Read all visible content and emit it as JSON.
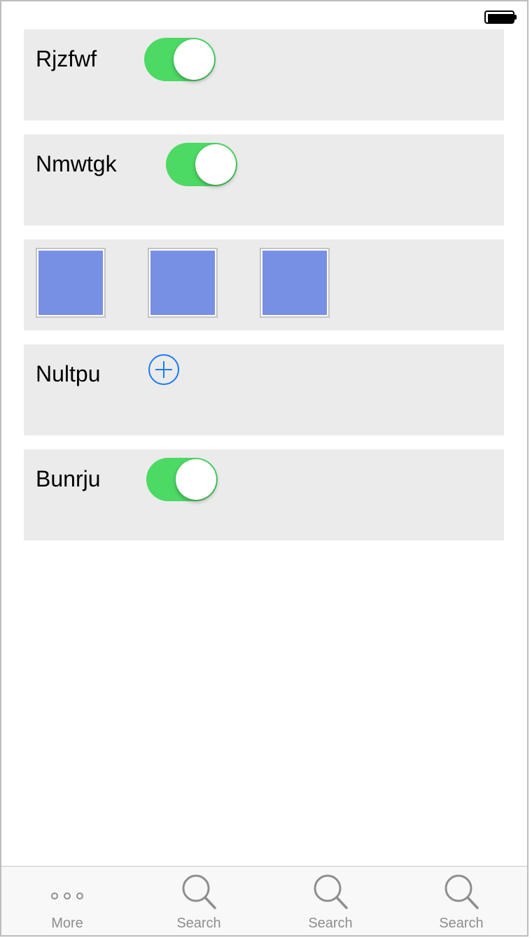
{
  "rows": [
    {
      "label": "Rjzfwf",
      "toggle_on": true
    },
    {
      "label": "Nmwtgk",
      "toggle_on": true
    },
    {
      "thumbnails": [
        "image-1",
        "image-2",
        "image-3"
      ]
    },
    {
      "label": "Nultpu",
      "action_icon": "add-circle-icon"
    },
    {
      "label": "Bunrju",
      "toggle_on": true
    }
  ],
  "colors": {
    "toggle_on": "#4cd964",
    "thumbnail_fill": "#7890e3",
    "accent": "#1a7cf0",
    "card_bg": "#ebebeb",
    "tab_inactive": "#8e8e8e"
  },
  "tab_bar": {
    "tabs": [
      {
        "label": "More",
        "icon": "more-icon"
      },
      {
        "label": "Search",
        "icon": "search-icon"
      },
      {
        "label": "Search",
        "icon": "search-icon"
      },
      {
        "label": "Search",
        "icon": "search-icon"
      }
    ]
  }
}
